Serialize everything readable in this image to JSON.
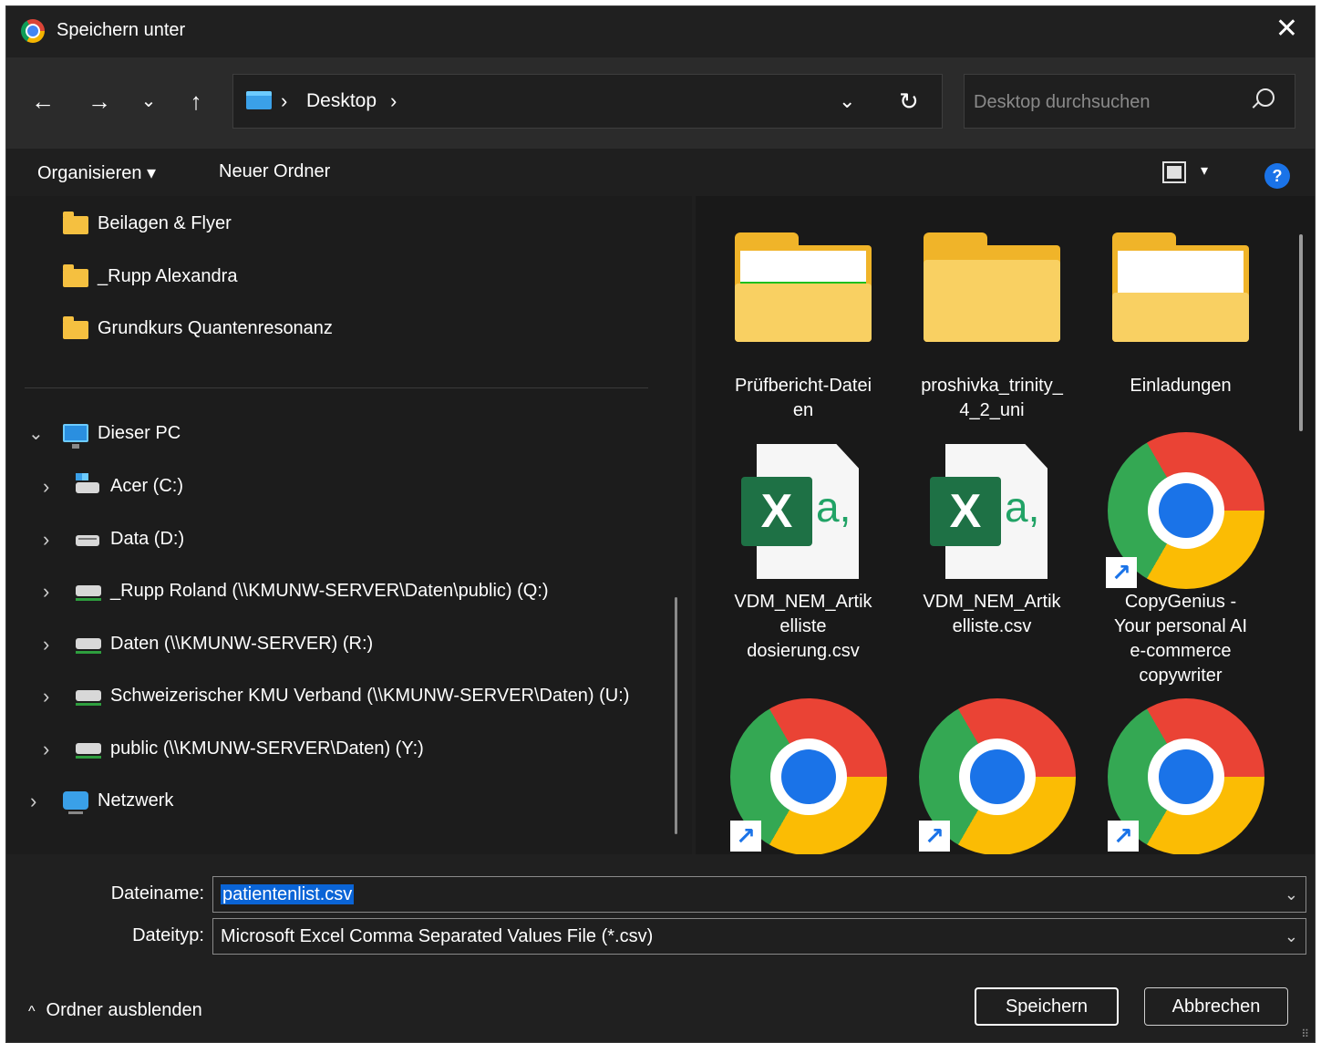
{
  "window": {
    "title": "Speichern unter",
    "app_icon": "chrome-icon",
    "close_label": "✕"
  },
  "nav": {
    "back": "←",
    "forward": "→",
    "recent": "⌄",
    "up": "↑",
    "breadcrumb_sep": "›",
    "location": "Desktop",
    "dropdown": "⌄",
    "refresh": "↻"
  },
  "search": {
    "placeholder": "Desktop durchsuchen",
    "value": ""
  },
  "commands": {
    "organize": "Organisieren ▾",
    "new_folder": "Neuer Ordner",
    "view_dropdown": "▾",
    "help": "?"
  },
  "tree": {
    "quick_folders": [
      "Beilagen & Flyer",
      "_Rupp Alexandra",
      "Grundkurs Quantenresonanz"
    ],
    "this_pc": "Dieser PC",
    "drives": [
      "Acer (C:)",
      "Data (D:)",
      "_Rupp Roland (\\\\KMUNW-SERVER\\Daten\\public) (Q:)",
      "Daten (\\\\KMUNW-SERVER) (R:)",
      "Schweizerischer KMU Verband (\\\\KMUNW-SERVER\\Daten) (U:)",
      "public (\\\\KMUNW-SERVER\\Daten) (Y:)"
    ],
    "network": "Netzwerk",
    "chev_open": "⌄",
    "chev_closed": "›"
  },
  "files": [
    {
      "name_lines": [
        "Prüfbericht-Datei",
        "en"
      ],
      "icon": "folder-icon"
    },
    {
      "name_lines": [
        "proshivka_trinity_",
        "4_2_uni"
      ],
      "icon": "folder-icon"
    },
    {
      "name_lines": [
        "Einladungen"
      ],
      "icon": "folder-icon"
    },
    {
      "name_lines": [
        "VDM_NEM_Artik",
        "elliste",
        "dosierung.csv"
      ],
      "icon": "excel-csv-icon"
    },
    {
      "name_lines": [
        "VDM_NEM_Artik",
        "elliste.csv"
      ],
      "icon": "excel-csv-icon"
    },
    {
      "name_lines": [
        "CopyGenius -",
        "Your personal AI",
        "e-commerce",
        "copywriter"
      ],
      "icon": "chrome-shortcut-icon"
    },
    {
      "icon": "chrome-shortcut-icon"
    },
    {
      "icon": "chrome-shortcut-icon"
    },
    {
      "icon": "chrome-shortcut-icon"
    }
  ],
  "excel_glyph": {
    "x": "X",
    "a": "a,"
  },
  "shortcut_glyph": "↗",
  "form": {
    "filename_label": "Dateiname:",
    "filename_value": "patientenlist.csv",
    "filetype_label": "Dateityp:",
    "filetype_value": "Microsoft Excel Comma Separated Values File (*.csv)",
    "dropdown": "⌄"
  },
  "footer": {
    "hide_folders_caret": "^",
    "hide_folders": "Ordner ausblenden",
    "save": "Speichern",
    "cancel": "Abbrechen",
    "grip": "⠿"
  },
  "colors": {
    "selection": "#0a64d6",
    "folder": "#f0b429",
    "excel_green": "#1e7145",
    "accent_blue": "#1a73e8"
  }
}
